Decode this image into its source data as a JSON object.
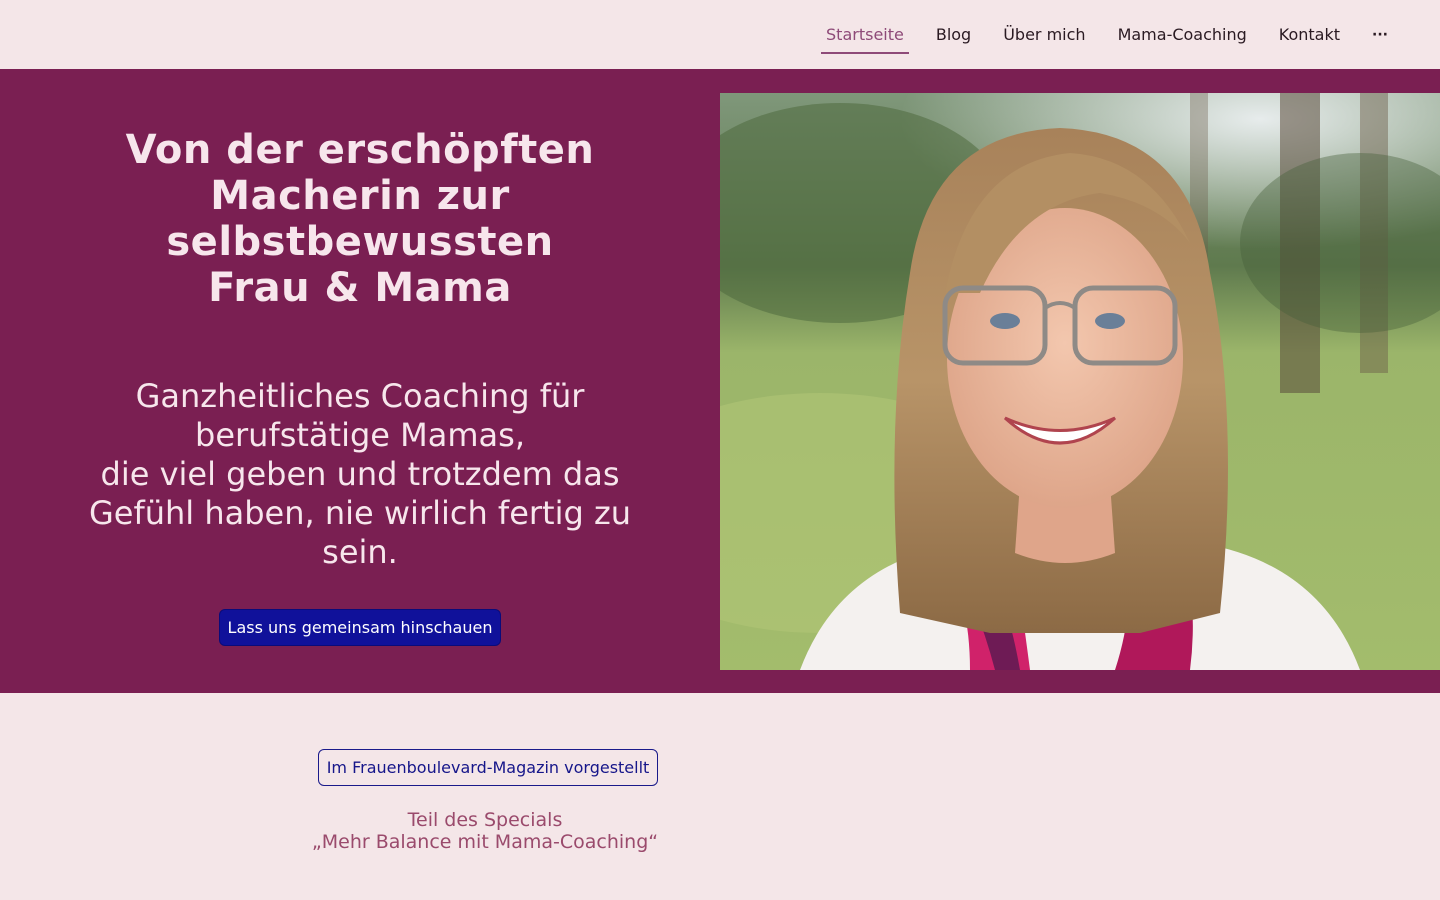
{
  "nav": {
    "items": [
      {
        "label": "Startseite"
      },
      {
        "label": "Blog"
      },
      {
        "label": "Über mich"
      },
      {
        "label": "Mama-Coaching"
      },
      {
        "label": "Kontakt"
      }
    ],
    "more_label": "···"
  },
  "hero": {
    "title": "Von der erschöpften\nMacherin zur\nselbstbewussten\nFrau & Mama",
    "subtitle": "Ganzheitliches Coaching für\nberufstätige Mamas,\ndie viel geben und trotzdem das\nGefühl haben, nie wirlich fertig zu\nsein.",
    "cta_label": "Lass uns gemeinsam hinschauen"
  },
  "press": {
    "button_label": "Im Frauenboulevard-Magazin vorgestellt",
    "note": "Teil des Specials\n„Mehr Balance mit Mama-Coaching“"
  },
  "colors": {
    "background": "#f4e6e8",
    "hero_bg": "#7a1f52",
    "cta_bg": "#10119a",
    "active_nav": "#8e4a78"
  }
}
